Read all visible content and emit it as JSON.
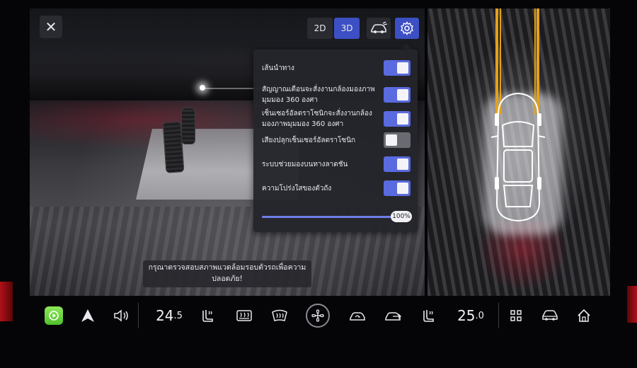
{
  "view_modes": {
    "mode_2d": "2D",
    "mode_3d": "3D",
    "active": "3D"
  },
  "settings_panel": {
    "rows": [
      {
        "label": "เส้นนำทาง",
        "enabled": true
      },
      {
        "label": "สัญญาณเตือนจะสั่งงานกล้องมองภาพมุมมอง 360 องศา",
        "enabled": true
      },
      {
        "label": "เซ็นเซอร์อัลตราโซนิกจะสั่งงานกล้องมองภาพมุมมอง 360 องศา",
        "enabled": true
      },
      {
        "label": "เสียงปลุกเซ็นเซอร์อัลตราโซนิก",
        "enabled": false
      },
      {
        "label": "ระบบช่วยมองบนทางลาดชัน",
        "enabled": true
      },
      {
        "label": "ความโปร่งใสของตัวถัง",
        "enabled": true
      }
    ],
    "transparency_value": "100%",
    "transparency_fraction": 1.0
  },
  "toast": {
    "message": "กรุณาตรวจสอบสภาพแวดล้อมรอบตัวรถเพื่อความปลอดภัย!"
  },
  "bottom_bar": {
    "temp_left": {
      "whole": "24",
      "decimal": ".5"
    },
    "temp_right": {
      "whole": "25",
      "decimal": ".0"
    }
  },
  "colors": {
    "accent": "#3d4fc4",
    "toggle_on": "#5a6adf",
    "guide_line": "#e3a21a",
    "carplay": "#6cd63c"
  }
}
